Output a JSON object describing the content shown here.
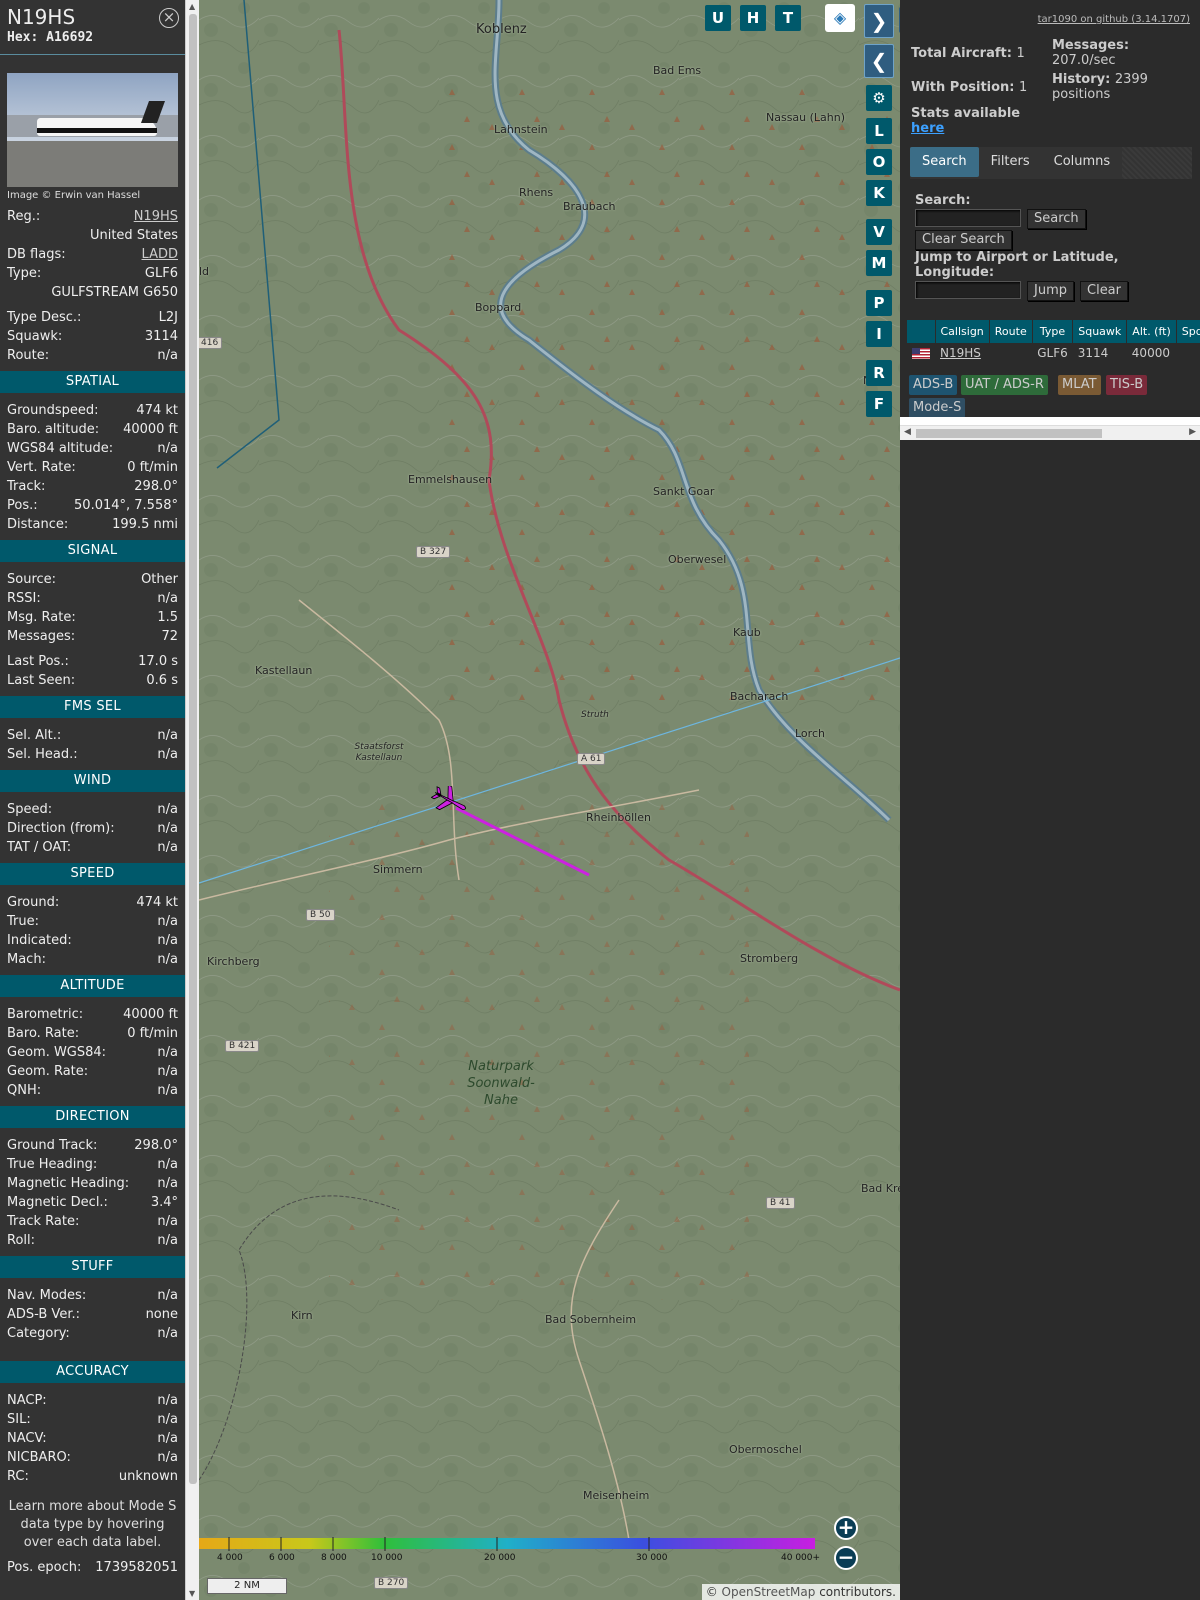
{
  "aircraft": {
    "callsign": "N19HS",
    "hex_label": "Hex:",
    "hex": "A16692",
    "photo_credit": "Image © Erwin van Hassel",
    "reg_label": "Reg.:",
    "reg": "N19HS",
    "country": "United States",
    "dbflags_label": "DB flags:",
    "dbflags": "LADD",
    "type_label": "Type:",
    "type": "GLF6",
    "type_full": "GULFSTREAM G650",
    "typedesc_label": "Type Desc.:",
    "typedesc": "L2J",
    "squawk_label": "Squawk:",
    "squawk": "3114",
    "route_label": "Route:",
    "route": "n/a"
  },
  "sections": {
    "spatial": {
      "title": "SPATIAL",
      "rows": [
        {
          "label": "Groundspeed:",
          "value": "474 kt"
        },
        {
          "label": "Baro. altitude:",
          "value": "40000 ft"
        },
        {
          "label": "WGS84 altitude:",
          "value": "n/a"
        },
        {
          "label": "Vert. Rate:",
          "value": "0 ft/min"
        },
        {
          "label": "Track:",
          "value": "298.0°"
        },
        {
          "label": "Pos.:",
          "value": "50.014°, 7.558°"
        },
        {
          "label": "Distance:",
          "value": "199.5 nmi"
        }
      ]
    },
    "signal": {
      "title": "SIGNAL",
      "rows": [
        {
          "label": "Source:",
          "value": "Other"
        },
        {
          "label": "RSSI:",
          "value": "n/a"
        },
        {
          "label": "Msg. Rate:",
          "value": "1.5"
        },
        {
          "label": "Messages:",
          "value": "72"
        },
        {
          "label": "Last Pos.:",
          "value": "17.0 s"
        },
        {
          "label": "Last Seen:",
          "value": "0.6 s"
        }
      ]
    },
    "fmssel": {
      "title": "FMS SEL",
      "rows": [
        {
          "label": "Sel. Alt.:",
          "value": "n/a"
        },
        {
          "label": "Sel. Head.:",
          "value": "n/a"
        }
      ]
    },
    "wind": {
      "title": "WIND",
      "rows": [
        {
          "label": "Speed:",
          "value": "n/a"
        },
        {
          "label": "Direction (from):",
          "value": "n/a"
        },
        {
          "label": "TAT / OAT:",
          "value": "n/a"
        }
      ]
    },
    "speed": {
      "title": "SPEED",
      "rows": [
        {
          "label": "Ground:",
          "value": "474 kt"
        },
        {
          "label": "True:",
          "value": "n/a"
        },
        {
          "label": "Indicated:",
          "value": "n/a"
        },
        {
          "label": "Mach:",
          "value": "n/a"
        }
      ]
    },
    "altitude": {
      "title": "ALTITUDE",
      "rows": [
        {
          "label": "Barometric:",
          "value": "40000 ft"
        },
        {
          "label": "Baro. Rate:",
          "value": "0 ft/min"
        },
        {
          "label": "Geom. WGS84:",
          "value": "n/a"
        },
        {
          "label": "Geom. Rate:",
          "value": "n/a"
        },
        {
          "label": "QNH:",
          "value": "n/a"
        }
      ]
    },
    "direction": {
      "title": "DIRECTION",
      "rows": [
        {
          "label": "Ground Track:",
          "value": "298.0°"
        },
        {
          "label": "True Heading:",
          "value": "n/a"
        },
        {
          "label": "Magnetic Heading:",
          "value": "n/a"
        },
        {
          "label": "Magnetic Decl.:",
          "value": "3.4°"
        },
        {
          "label": "Track Rate:",
          "value": "n/a"
        },
        {
          "label": "Roll:",
          "value": "n/a"
        }
      ]
    },
    "stuff": {
      "title": "STUFF",
      "rows": [
        {
          "label": "Nav. Modes:",
          "value": "n/a"
        },
        {
          "label": "ADS-B Ver.:",
          "value": "none"
        },
        {
          "label": "Category:",
          "value": "n/a"
        }
      ]
    },
    "accuracy": {
      "title": "ACCURACY",
      "rows": [
        {
          "label": "NACP:",
          "value": "n/a"
        },
        {
          "label": "SIL:",
          "value": "n/a"
        },
        {
          "label": "NACV:",
          "value": "n/a"
        },
        {
          "label": "NICBARO:",
          "value": "n/a"
        },
        {
          "label": "RC:",
          "value": "unknown"
        }
      ]
    }
  },
  "learn_more": "Learn more about Mode S data type by hovering over each data label.",
  "pos_epoch_label": "Pos. epoch:",
  "pos_epoch": "1739582051",
  "map": {
    "top_buttons": [
      "U",
      "H",
      "T"
    ],
    "side_buttons": [
      "L",
      "O",
      "K",
      "V",
      "M",
      "P",
      "I",
      "R",
      "F"
    ],
    "cities": [
      {
        "name": "Koblenz"
      },
      {
        "name": "Bad Ems"
      },
      {
        "name": "Lahnstein"
      },
      {
        "name": "Nassau (Lahn)"
      },
      {
        "name": "Rhens"
      },
      {
        "name": "Braubach"
      },
      {
        "name": "Boppard"
      },
      {
        "name": "Emmelshausen"
      },
      {
        "name": "Sankt Goar"
      },
      {
        "name": "Oberwesel"
      },
      {
        "name": "Kaub"
      },
      {
        "name": "Kastellaun"
      },
      {
        "name": "Bacharach"
      },
      {
        "name": "Lorch"
      },
      {
        "name": "Rheinböllen"
      },
      {
        "name": "Simmern"
      },
      {
        "name": "Kirchberg"
      },
      {
        "name": "Stromberg"
      },
      {
        "name": "Bad Kre"
      },
      {
        "name": "Kirn"
      },
      {
        "name": "Bad Sobernheim"
      },
      {
        "name": "Obermoschel"
      },
      {
        "name": "Meisenheim"
      },
      {
        "name": "Struth"
      },
      {
        "name": "Staatsforst Kastellaun"
      },
      {
        "name": "ld"
      },
      {
        "name": "N"
      }
    ],
    "road_badges": [
      "B 327",
      "A 61",
      "B 50",
      "B 421",
      "B 41",
      "B 270",
      "416"
    ],
    "park": "Naturpark Soonwald-Nahe",
    "scale_labels": [
      "4 000",
      "6 000",
      "8 000",
      "10 000",
      "20 000",
      "30 000",
      "40 000+"
    ],
    "scale_nm": "2 NM",
    "attribution_prefix": "© ",
    "attribution_link": "OpenStreetMap",
    "attribution_suffix": " contributors."
  },
  "panel": {
    "github": "tar1090 on github (3.14.1707)",
    "total_label": "Total Aircraft:",
    "total": "1",
    "withpos_label": "With Position:",
    "withpos": "1",
    "stats_label": "Stats available",
    "stats_link": "here",
    "messages_label": "Messages:",
    "messages": "207.0/sec",
    "history_label": "History:",
    "history_count": "2399",
    "history_unit": "positions",
    "tabs": [
      "Search",
      "Filters",
      "Columns"
    ],
    "search_label": "Search:",
    "search_button": "Search",
    "clear_search_button": "Clear Search",
    "jump_label": "Jump to Airport or Latitude, Longitude:",
    "jump_button": "Jump",
    "clear_button": "Clear",
    "table": {
      "headers": [
        "Callsign",
        "Route",
        "Type",
        "Squawk",
        "Alt. (ft)",
        "Spd."
      ],
      "rows": [
        {
          "callsign": "N19HS",
          "route": "",
          "type": "GLF6",
          "squawk": "3114",
          "alt": "40000"
        }
      ]
    },
    "legend": [
      {
        "label": "ADS-B",
        "bg": "#1e5470"
      },
      {
        "label": "UAT / ADS-R",
        "bg": "#2e6b3a"
      },
      {
        "label": "MLAT",
        "bg": "#7a5a34"
      },
      {
        "label": "TIS-B",
        "bg": "#7a2a3a"
      },
      {
        "label": "Mode-S",
        "bg": "#2f4e63"
      }
    ]
  }
}
